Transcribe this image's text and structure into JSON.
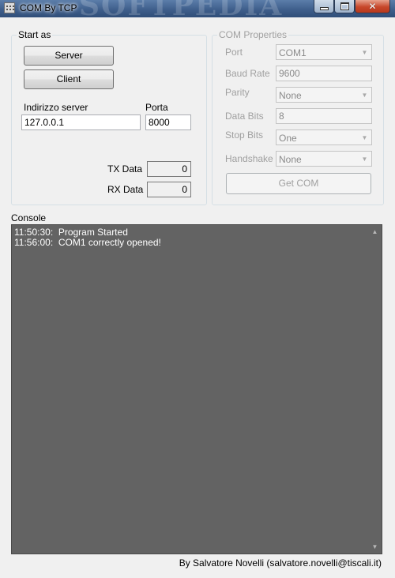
{
  "window": {
    "title": "COM By TCP",
    "watermark": "SOFTPEDIA"
  },
  "start_group": {
    "legend": "Start as",
    "server_button": "Server",
    "client_button": "Client",
    "server_label": "Indirizzo server",
    "server_value": "127.0.0.1",
    "port_label": "Porta",
    "port_value": "8000",
    "tx_label": "TX Data",
    "tx_value": "0",
    "rx_label": "RX Data",
    "rx_value": "0"
  },
  "com_group": {
    "legend": "COM Properties",
    "port_label": "Port",
    "port_value": "COM1",
    "baud_label": "Baud Rate",
    "baud_value": "9600",
    "parity_label": "Parity",
    "parity_value": "None",
    "databits_label": "Data Bits",
    "databits_value": "8",
    "stopbits_label": "Stop Bits",
    "stopbits_value": "One",
    "handshake_label": "Handshake",
    "handshake_value": "None",
    "get_com_button": "Get COM"
  },
  "console": {
    "label": "Console",
    "lines": [
      {
        "time": "11:50:30:",
        "text": "Program Started"
      },
      {
        "time": "11:56:00:",
        "text": "COM1 correctly opened!"
      }
    ]
  },
  "footer": "By Salvatore Novelli (salvatore.novelli@tiscali.it)",
  "colors": {
    "titlebar": "#3f5f8c",
    "console_bg": "#636363",
    "window_bg": "#f0f0f0"
  },
  "icons": {
    "app": "app-icon",
    "minimize": "minimize-icon",
    "maximize": "maximize-icon",
    "close": "close-icon",
    "dropdown": "chevron-down-icon"
  }
}
